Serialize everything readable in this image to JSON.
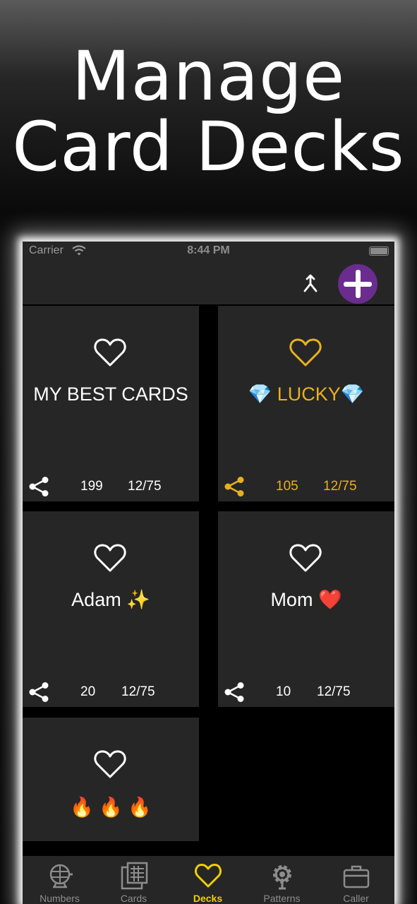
{
  "headline": {
    "line1": "Manage",
    "line2": "Card Decks"
  },
  "status_bar": {
    "carrier": "Carrier",
    "time": "8:44 PM"
  },
  "nav": {
    "merge_icon": "merge-icon",
    "add_icon": "plus-icon",
    "add_color": "#6a2c8e"
  },
  "decks": [
    {
      "title": "MY BEST CARDS",
      "count": "199",
      "ratio": "12/75",
      "favorite": false
    },
    {
      "title": "💎 LUCKY💎",
      "count": "105",
      "ratio": "12/75",
      "favorite": true
    },
    {
      "title": "Adam ✨",
      "count": "20",
      "ratio": "12/75",
      "favorite": false
    },
    {
      "title": "Mom ❤️",
      "count": "10",
      "ratio": "12/75",
      "favorite": false
    },
    {
      "title": "🔥 🔥 🔥",
      "favorite": false
    }
  ],
  "colors": {
    "favorite": "#e8b020",
    "tab_active": "#f0d000",
    "tab_inactive": "#8d8d8d",
    "card_bg": "#262626"
  },
  "tabs": [
    {
      "label": "Numbers",
      "icon": "lottery-cage-icon",
      "active": false
    },
    {
      "label": "Cards",
      "icon": "bingo-card-icon",
      "active": false
    },
    {
      "label": "Decks",
      "icon": "heart-icon",
      "active": true
    },
    {
      "label": "Patterns",
      "icon": "gear-icon",
      "active": false
    },
    {
      "label": "Caller",
      "icon": "briefcase-icon",
      "active": false
    }
  ]
}
